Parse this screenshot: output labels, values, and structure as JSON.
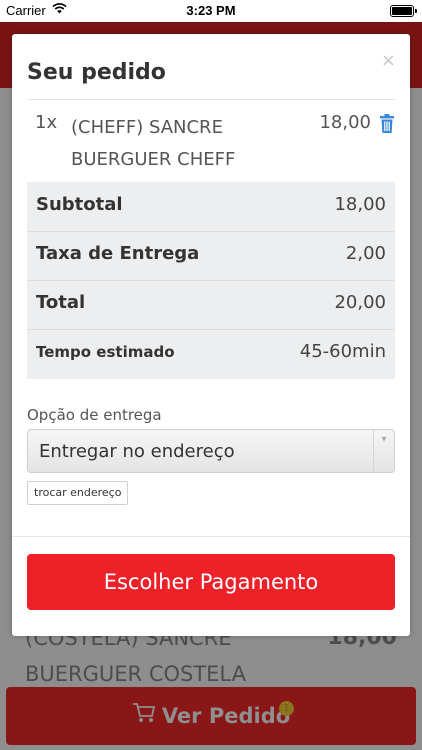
{
  "status_bar": {
    "carrier": "Carrier",
    "time": "3:23 PM"
  },
  "background": {
    "item_name": "(COSTELA) SANCRE BUERGUER COSTELA",
    "item_price": "18,00",
    "cart_button_label": "Ver Pedido",
    "cart_count": "1"
  },
  "modal": {
    "title": "Seu pedido",
    "close_symbol": "×",
    "items": [
      {
        "qty": "1x",
        "name": "(CHEFF) SANCRE BUERGUER CHEFF",
        "price": "18,00"
      }
    ],
    "summary": {
      "subtotal_label": "Subtotal",
      "subtotal_value": "18,00",
      "delivery_fee_label": "Taxa de Entrega",
      "delivery_fee_value": "2,00",
      "total_label": "Total",
      "total_value": "20,00",
      "eta_label": "Tempo estimado",
      "eta_value": "45-60min"
    },
    "delivery_option_label": "Opção de entrega",
    "delivery_option_value": "Entregar no endereço",
    "change_address_label": "trocar endereço",
    "pay_button_label": "Escolher Pagamento"
  },
  "colors": {
    "accent": "#ee2128",
    "trash_icon": "#3a87d6",
    "summary_bg": "#eceeef"
  }
}
